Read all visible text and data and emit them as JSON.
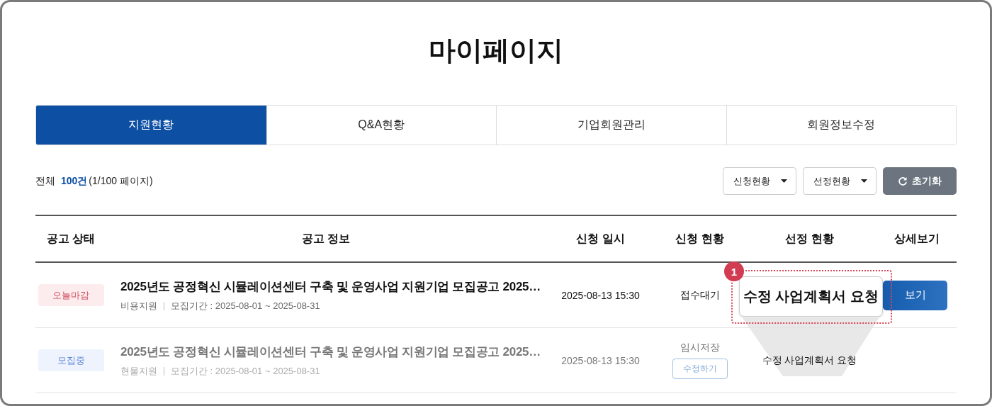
{
  "page_title": "마이페이지",
  "tabs": [
    {
      "label": "지원현황",
      "selected": true
    },
    {
      "label": "Q&A현황",
      "selected": false
    },
    {
      "label": "기업회원관리",
      "selected": false
    },
    {
      "label": "회원정보수정",
      "selected": false
    }
  ],
  "summary": {
    "label": "전체",
    "count": "100건",
    "pages": "(1/100 페이지)"
  },
  "filters": [
    {
      "label": "신청현황"
    },
    {
      "label": "선정현황"
    }
  ],
  "reset_button": {
    "label": "초기화"
  },
  "table": {
    "columns": [
      "공고 상태",
      "공고 정보",
      "신청 일시",
      "신청 현황",
      "선정 현황",
      "상세보기"
    ],
    "rows": [
      {
        "dimmed": false,
        "status": {
          "kind": "deadline",
          "label": "오늘마감"
        },
        "title": "2025년도 공정혁신 시뮬레이션센터 구축 및 운영사업 지원기업 모집공고 2025…",
        "category": "비용지원",
        "period": "모집기간 : 2025-08-01 ~ 2025-08-31",
        "date": "2025-08-13 15:30",
        "application_status": "접수대기",
        "detail_button": "보기"
      },
      {
        "dimmed": true,
        "status": {
          "kind": "recruiting",
          "label": "모집중"
        },
        "title": "2025년도 공정혁신 시뮬레이션센터 구축 및 운영사업 지원기업 모집공고 2025…",
        "category": "현물지원",
        "period": "모집기간 : 2025-08-01 ~ 2025-08-31",
        "date": "2025-08-13 15:30",
        "application_status": "임시저장",
        "edit_button": "수정하기",
        "selection_status": "수정 사업계획서 요청"
      }
    ]
  },
  "callout": {
    "number": "1",
    "text": "수정 사업계획서 요청"
  }
}
